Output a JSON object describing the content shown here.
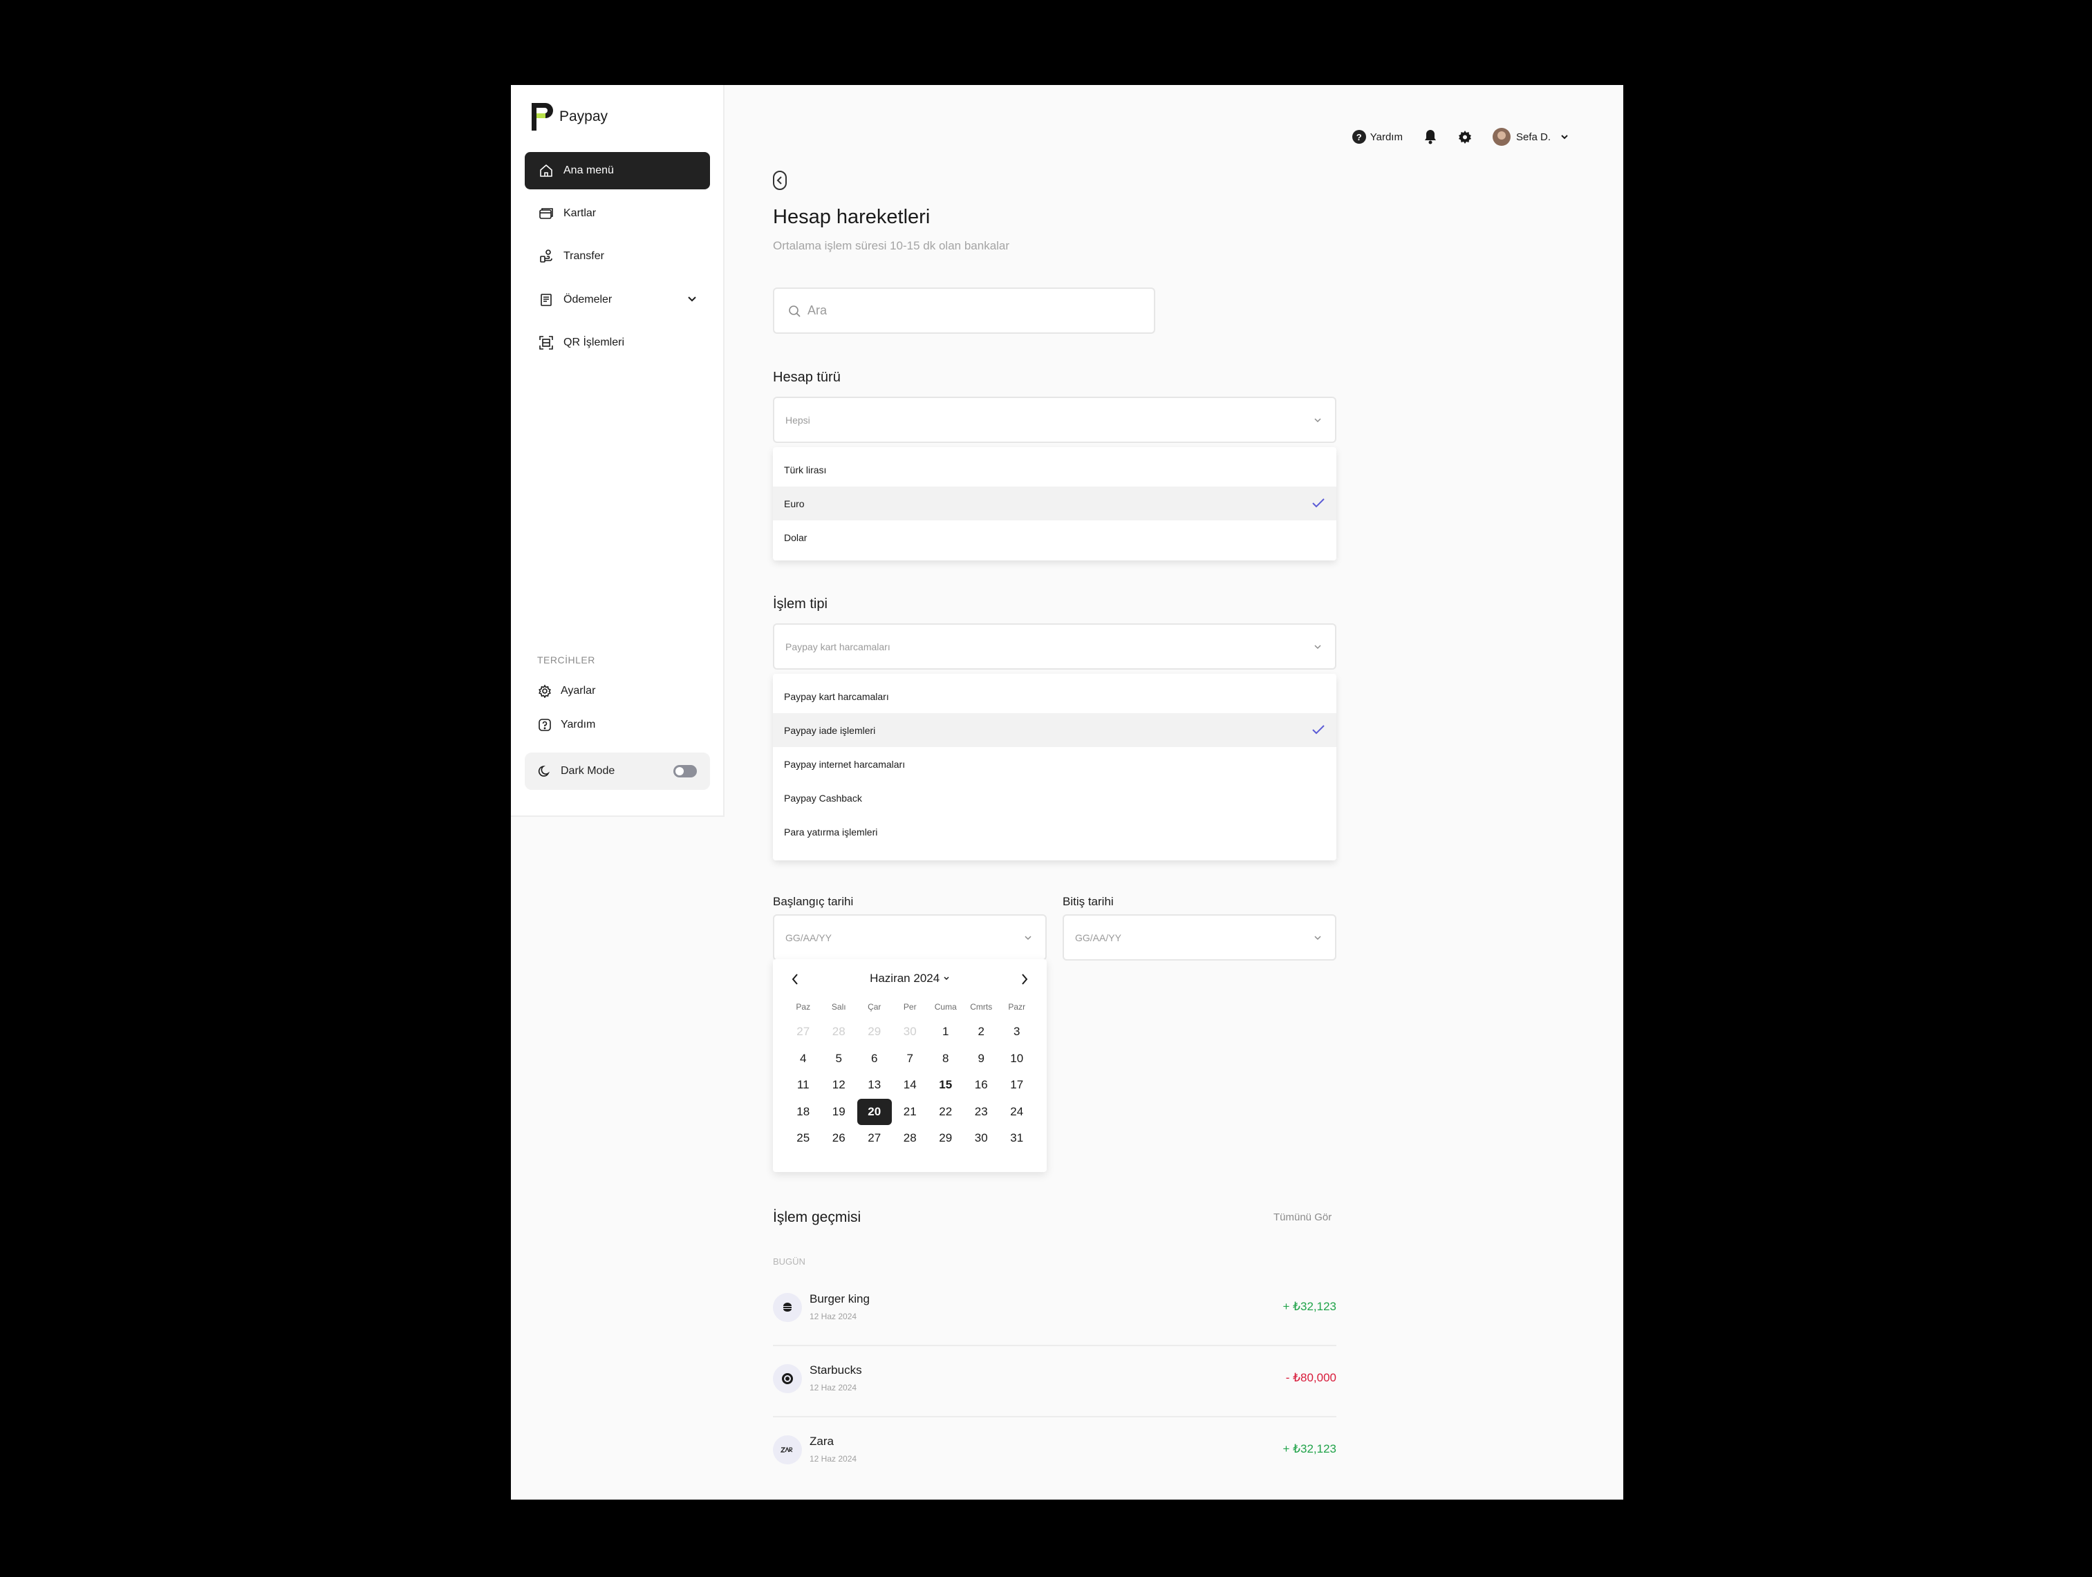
{
  "app": {
    "brand": "Paypay"
  },
  "sidebar": {
    "items": [
      {
        "label": "Ana menü",
        "icon": "home-icon"
      },
      {
        "label": "Kartlar",
        "icon": "card-icon"
      },
      {
        "label": "Transfer",
        "icon": "transfer-icon"
      },
      {
        "label": "Ödemeler",
        "icon": "receipt-icon"
      },
      {
        "label": "QR İşlemleri",
        "icon": "qr-scan-icon"
      }
    ],
    "preferences_label": "TERCİHLER",
    "preferences": [
      {
        "label": "Ayarlar",
        "icon": "gear-icon"
      },
      {
        "label": "Yardım",
        "icon": "help-icon"
      }
    ],
    "dark_mode_label": "Dark Mode"
  },
  "topbar": {
    "help": "Yardım",
    "user": "Sefa D."
  },
  "main": {
    "title": "Hesap hareketleri",
    "subtitle": "Ortalama işlem süresi 10-15 dk olan bankalar",
    "search_placeholder": "Ara",
    "account_type": {
      "label": "Hesap türü",
      "value": "Hepsi",
      "options": [
        "Türk lirası",
        "Euro",
        "Dolar"
      ],
      "selected_option": "Euro"
    },
    "transaction_type": {
      "label": "İşlem tipi",
      "value": "Paypay kart harcamaları",
      "options": [
        "Paypay kart harcamaları",
        "Paypay iade işlemleri",
        "Paypay internet harcamaları",
        "Paypay Cashback",
        "Para yatırma işlemleri"
      ],
      "selected_option": "Paypay iade işlemleri"
    },
    "start_date": {
      "label": "Başlangıç tarihi",
      "placeholder": "GG/AA/YY"
    },
    "end_date": {
      "label": "Bitiş tarihi",
      "placeholder": "GG/AA/YY"
    },
    "calendar": {
      "month": "Haziran 2024",
      "weekdays": [
        "Paz",
        "Salı",
        "Çar",
        "Per",
        "Cuma",
        "Cmrts",
        "Pazr"
      ],
      "leading_days": [
        "27",
        "28",
        "29",
        "30"
      ],
      "days": [
        "1",
        "2",
        "3",
        "4",
        "5",
        "6",
        "7",
        "8",
        "9",
        "10",
        "11",
        "12",
        "13",
        "14",
        "15",
        "16",
        "17",
        "18",
        "19",
        "20",
        "21",
        "22",
        "23",
        "24",
        "25",
        "26",
        "27",
        "28",
        "29",
        "30",
        "31"
      ],
      "selected_day": "20",
      "highlighted_day": "15"
    },
    "history": {
      "title": "İşlem geçmisi",
      "see_all": "Tümünü Gör",
      "group_label": "BUGÜN",
      "transactions": [
        {
          "name": "Burger king",
          "date": "12 Haz 2024",
          "amount": "+ ₺32,123",
          "sign": "positive",
          "icon": "burger-king-logo-icon"
        },
        {
          "name": "Starbucks",
          "date": "12 Haz 2024",
          "amount": "- ₺80,000",
          "sign": "negative",
          "icon": "starbucks-logo-icon"
        },
        {
          "name": "Zara",
          "date": "12 Haz 2024",
          "amount": "+ ₺32,123",
          "sign": "positive",
          "icon": "zara-logo-icon"
        }
      ]
    }
  },
  "colors": {
    "accent_dark": "#222222",
    "check": "#5b5bd6",
    "positive": "#21a34a",
    "negative": "#d81b3a",
    "logo_accent": "#b7e04a"
  }
}
